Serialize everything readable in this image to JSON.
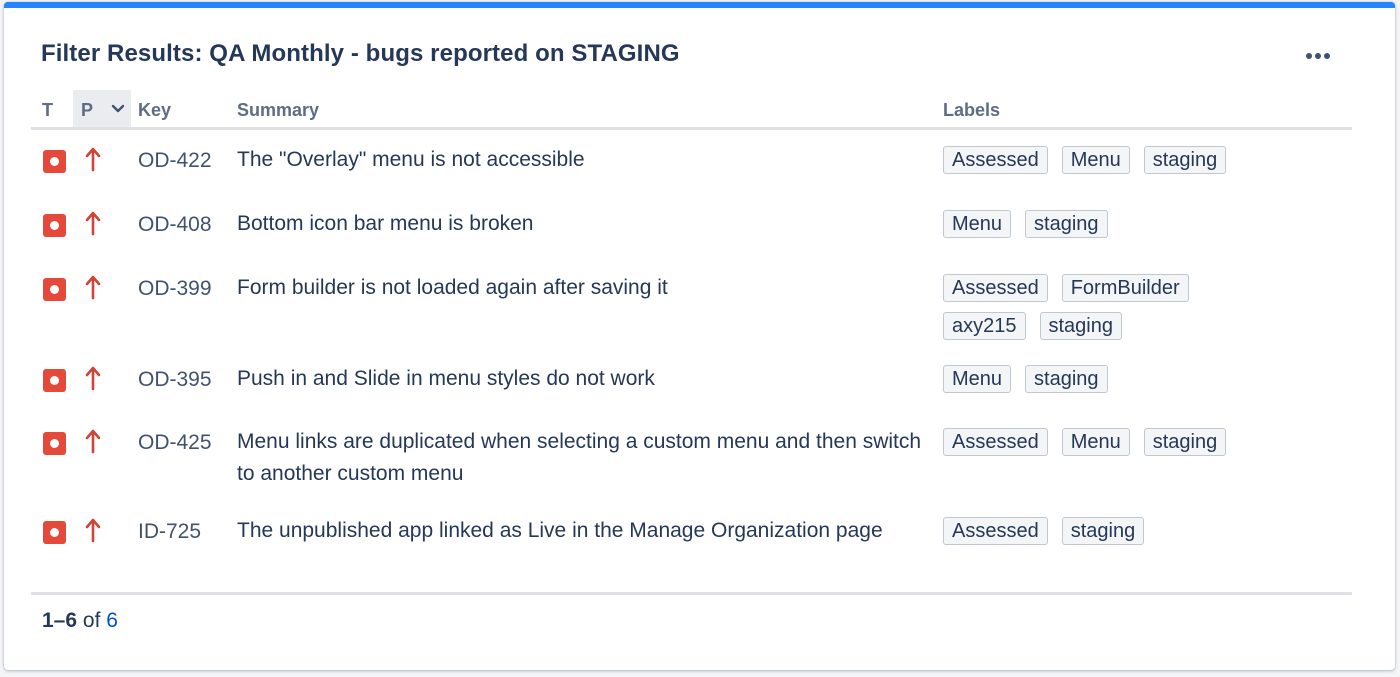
{
  "gadget": {
    "title": "Filter Results: QA Monthly - bugs reported on STAGING",
    "more_icon": "more-horizontal-icon"
  },
  "table": {
    "columns": {
      "type": "T",
      "priority": "P",
      "key": "Key",
      "summary": "Summary",
      "labels": "Labels"
    },
    "rows": [
      {
        "type_icon": "bug-icon",
        "priority_icon": "priority-high-icon",
        "key": "OD-422",
        "summary": "The \"Overlay\" menu is not accessible",
        "labels": [
          "Assessed",
          "Menu",
          "staging"
        ]
      },
      {
        "type_icon": "bug-icon",
        "priority_icon": "priority-high-icon",
        "key": "OD-408",
        "summary": "Bottom icon bar menu is broken",
        "labels": [
          "Menu",
          "staging"
        ]
      },
      {
        "type_icon": "bug-icon",
        "priority_icon": "priority-high-icon",
        "key": "OD-399",
        "summary": "Form builder is not loaded again after saving it",
        "labels": [
          "Assessed",
          "FormBuilder",
          "axy215",
          "staging"
        ]
      },
      {
        "type_icon": "bug-icon",
        "priority_icon": "priority-high-icon",
        "key": "OD-395",
        "summary": "Push in and Slide in menu styles do not work",
        "labels": [
          "Menu",
          "staging"
        ]
      },
      {
        "type_icon": "bug-icon",
        "priority_icon": "priority-high-icon",
        "key": "OD-425",
        "summary": "Menu links are duplicated when selecting a custom menu and then switch to another custom menu",
        "labels": [
          "Assessed",
          "Menu",
          "staging"
        ]
      },
      {
        "type_icon": "bug-icon",
        "priority_icon": "priority-high-icon",
        "key": "ID-725",
        "summary": "The unpublished app linked as Live in the Manage Organization page",
        "labels": [
          "Assessed",
          "staging"
        ]
      }
    ]
  },
  "pagination": {
    "range": "1–6",
    "of": "of",
    "total": "6"
  },
  "colors": {
    "accent": "#2684ff",
    "bug": "#e5493a",
    "priority_high": "#d04437"
  }
}
